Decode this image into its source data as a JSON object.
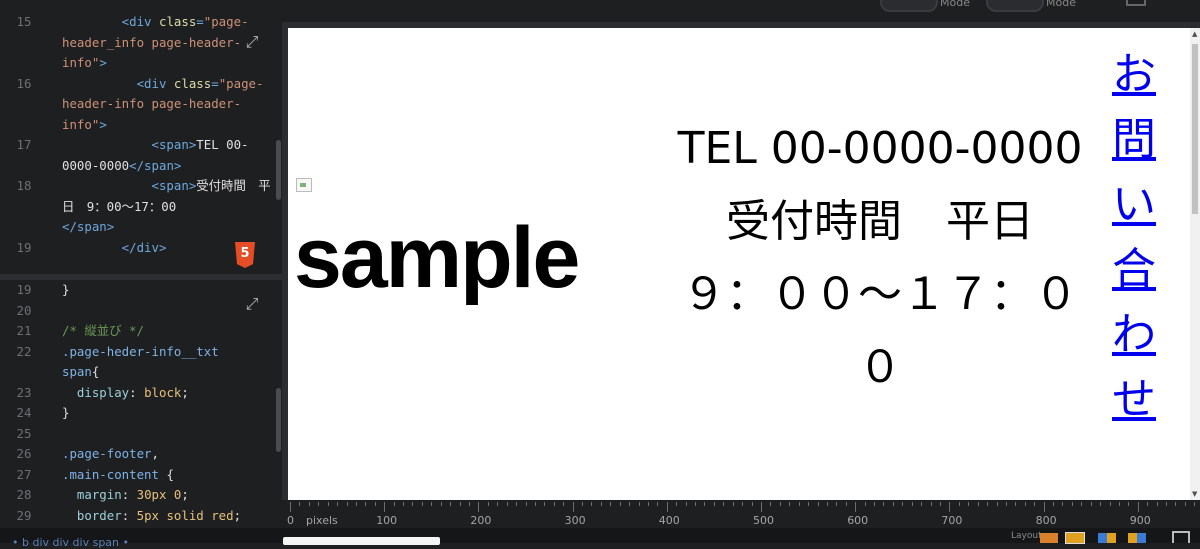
{
  "topbar": {
    "toggle_1_label": "Mode",
    "toggle_2_label": "Mode"
  },
  "html_editor": {
    "lines": [
      {
        "num": "15",
        "parts": [
          {
            "t": "tag",
            "v": "        <div "
          },
          {
            "t": "attr",
            "v": "class"
          },
          {
            "t": "tag",
            "v": "="
          },
          {
            "t": "str",
            "v": "\"page-"
          }
        ]
      },
      {
        "num": "",
        "parts": [
          {
            "t": "str",
            "v": "header_info page-header-"
          }
        ]
      },
      {
        "num": "",
        "parts": [
          {
            "t": "str",
            "v": "info\""
          },
          {
            "t": "tag",
            "v": ">"
          }
        ]
      },
      {
        "num": "16",
        "parts": [
          {
            "t": "tag",
            "v": "          <div "
          },
          {
            "t": "attr",
            "v": "class"
          },
          {
            "t": "tag",
            "v": "="
          },
          {
            "t": "str",
            "v": "\"page-"
          }
        ]
      },
      {
        "num": "",
        "parts": [
          {
            "t": "str",
            "v": "header-info page-header-"
          }
        ]
      },
      {
        "num": "",
        "parts": [
          {
            "t": "str",
            "v": "info\""
          },
          {
            "t": "tag",
            "v": ">"
          }
        ]
      },
      {
        "num": "17",
        "parts": [
          {
            "t": "tag",
            "v": "            <span>"
          },
          {
            "t": "txt",
            "v": "TEL 00-"
          }
        ]
      },
      {
        "num": "",
        "parts": [
          {
            "t": "txt",
            "v": "0000-0000"
          },
          {
            "t": "tag",
            "v": "</span>"
          }
        ]
      },
      {
        "num": "18",
        "parts": [
          {
            "t": "tag",
            "v": "            <span>"
          },
          {
            "t": "txt",
            "v": "受付時間　平"
          }
        ]
      },
      {
        "num": "",
        "parts": [
          {
            "t": "txt",
            "v": "日　9：00～17：00"
          }
        ]
      },
      {
        "num": "",
        "parts": [
          {
            "t": "tag",
            "v": "</span>"
          }
        ]
      },
      {
        "num": "19",
        "parts": [
          {
            "t": "tag",
            "v": "        </div>"
          }
        ]
      }
    ]
  },
  "css_editor": {
    "lines": [
      {
        "num": "19",
        "parts": [
          {
            "t": "txt",
            "v": "}"
          }
        ]
      },
      {
        "num": "20",
        "parts": []
      },
      {
        "num": "21",
        "parts": [
          {
            "t": "cmt",
            "v": "/* 縦並び */"
          }
        ]
      },
      {
        "num": "22",
        "parts": [
          {
            "t": "sel",
            "v": ".page-heder-info__txt"
          }
        ]
      },
      {
        "num": "",
        "parts": [
          {
            "t": "sel",
            "v": "span"
          },
          {
            "t": "txt",
            "v": "{"
          }
        ]
      },
      {
        "num": "23",
        "parts": [
          {
            "t": "prop",
            "v": "  display"
          },
          {
            "t": "txt",
            "v": ": "
          },
          {
            "t": "val",
            "v": "block"
          },
          {
            "t": "txt",
            "v": ";"
          }
        ]
      },
      {
        "num": "24",
        "parts": [
          {
            "t": "txt",
            "v": "}"
          }
        ]
      },
      {
        "num": "25",
        "parts": []
      },
      {
        "num": "26",
        "parts": [
          {
            "t": "sel",
            "v": ".page-footer"
          },
          {
            "t": "txt",
            "v": ","
          }
        ]
      },
      {
        "num": "27",
        "parts": [
          {
            "t": "sel",
            "v": ".main-content"
          },
          {
            "t": "txt",
            "v": " {"
          }
        ]
      },
      {
        "num": "28",
        "parts": [
          {
            "t": "prop",
            "v": "  margin"
          },
          {
            "t": "txt",
            "v": ": "
          },
          {
            "t": "val",
            "v": "30px 0"
          },
          {
            "t": "txt",
            "v": ";"
          }
        ]
      },
      {
        "num": "29",
        "parts": [
          {
            "t": "prop",
            "v": "  border"
          },
          {
            "t": "txt",
            "v": ": "
          },
          {
            "t": "val",
            "v": "5px solid red"
          },
          {
            "t": "txt",
            "v": ";"
          }
        ]
      }
    ]
  },
  "html_badge": "5",
  "preview": {
    "logo_text": "sample",
    "tel": "TEL 00-0000-0000",
    "hours": "受付時間　平日　９：００～１７：００",
    "contact_link": "お問い合わせ"
  },
  "ruler": {
    "unit_label": "pixels",
    "labels": [
      "0",
      "100",
      "200",
      "300",
      "400",
      "500",
      "600",
      "700",
      "800",
      "900"
    ]
  },
  "bottombar": {
    "breadcrumb": "• b  div  div  div  span  •",
    "layout_label": "Layout"
  },
  "colors": {
    "editor_bg": "#1e1f21",
    "link": "#0000ee",
    "html_badge": "#e44d26"
  }
}
